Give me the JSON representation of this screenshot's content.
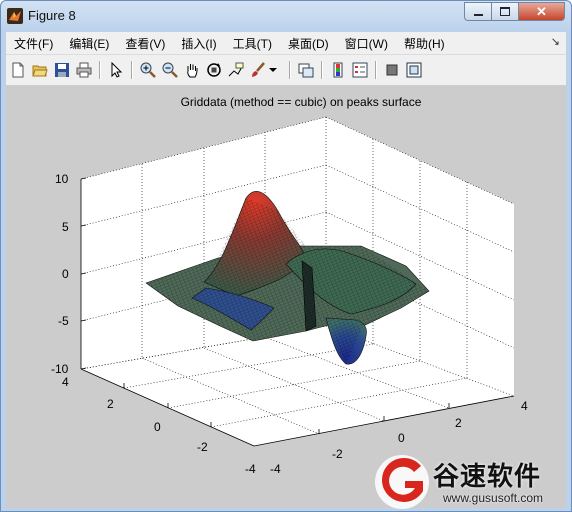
{
  "window": {
    "title": "Figure 8"
  },
  "menu": [
    "文件(F)",
    "编辑(E)",
    "查看(V)",
    "插入(I)",
    "工具(T)",
    "桌面(D)",
    "窗口(W)",
    "帮助(H)"
  ],
  "toolbar_icons": [
    "new-figure-icon",
    "open-file-icon",
    "save-icon",
    "print-icon",
    "edit-plot-arrow-icon",
    "zoom-in-icon",
    "zoom-out-icon",
    "pan-hand-icon",
    "rotate-3d-icon",
    "data-cursor-icon",
    "brush-icon",
    "brush-dropdown-icon",
    "link-plot-icon",
    "colorbar-icon",
    "legend-icon",
    "hide-plot-tools-icon",
    "show-plot-tools-icon"
  ],
  "plot": {
    "title": "Griddata (method == cubic) on peaks surface",
    "zticks": [
      "10",
      "5",
      "0",
      "-5",
      "-10"
    ],
    "yticks": [
      "4",
      "2",
      "0",
      "-2",
      "-4"
    ],
    "xticks": [
      "-4",
      "-2",
      "0",
      "2",
      "4"
    ]
  },
  "chart_data": {
    "type": "surface",
    "title": "Griddata (method == cubic) on peaks surface",
    "xlim": [
      -4,
      4
    ],
    "ylim": [
      -4,
      4
    ],
    "zlim": [
      -10,
      10
    ],
    "xticks": [
      -4,
      -2,
      0,
      2,
      4
    ],
    "yticks": [
      -4,
      -2,
      0,
      2,
      4
    ],
    "zticks": [
      -10,
      -5,
      0,
      5,
      10
    ],
    "grid": true,
    "colors": {
      "high": "#d02020",
      "mid": "#2a8a4a",
      "low": "#2a3aa0"
    }
  },
  "watermark": {
    "brand": "谷速软件",
    "url": "www.gususoft.com"
  }
}
